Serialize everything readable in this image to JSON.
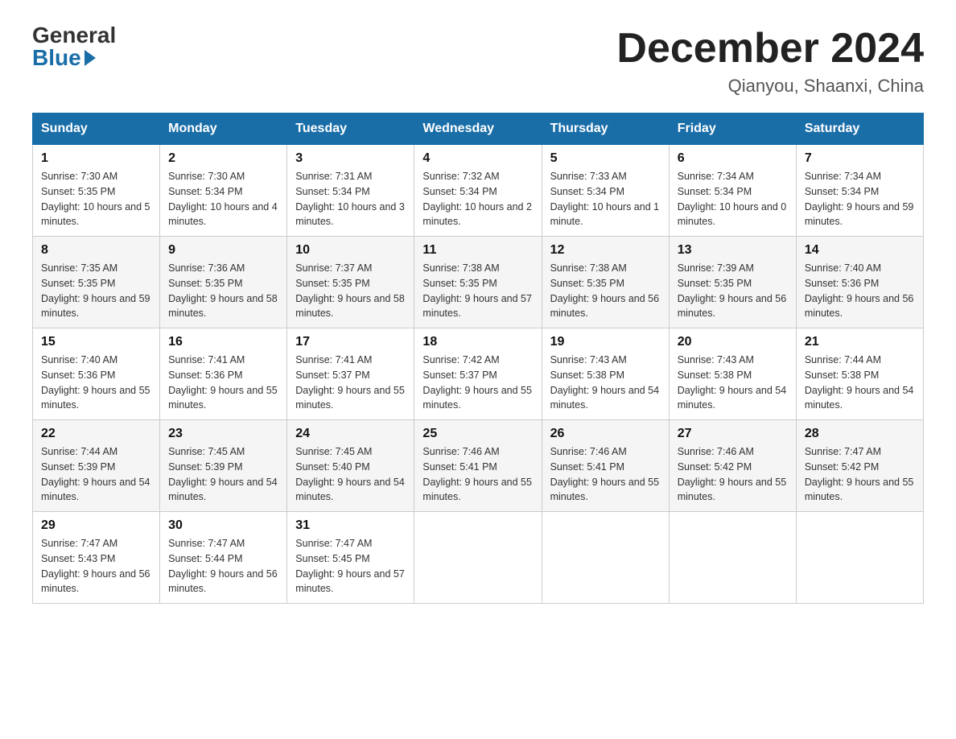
{
  "logo": {
    "general": "General",
    "blue": "Blue"
  },
  "header": {
    "month": "December 2024",
    "location": "Qianyou, Shaanxi, China"
  },
  "days_of_week": [
    "Sunday",
    "Monday",
    "Tuesday",
    "Wednesday",
    "Thursday",
    "Friday",
    "Saturday"
  ],
  "weeks": [
    [
      {
        "day": "1",
        "sunrise": "7:30 AM",
        "sunset": "5:35 PM",
        "daylight": "10 hours and 5 minutes."
      },
      {
        "day": "2",
        "sunrise": "7:30 AM",
        "sunset": "5:34 PM",
        "daylight": "10 hours and 4 minutes."
      },
      {
        "day": "3",
        "sunrise": "7:31 AM",
        "sunset": "5:34 PM",
        "daylight": "10 hours and 3 minutes."
      },
      {
        "day": "4",
        "sunrise": "7:32 AM",
        "sunset": "5:34 PM",
        "daylight": "10 hours and 2 minutes."
      },
      {
        "day": "5",
        "sunrise": "7:33 AM",
        "sunset": "5:34 PM",
        "daylight": "10 hours and 1 minute."
      },
      {
        "day": "6",
        "sunrise": "7:34 AM",
        "sunset": "5:34 PM",
        "daylight": "10 hours and 0 minutes."
      },
      {
        "day": "7",
        "sunrise": "7:34 AM",
        "sunset": "5:34 PM",
        "daylight": "9 hours and 59 minutes."
      }
    ],
    [
      {
        "day": "8",
        "sunrise": "7:35 AM",
        "sunset": "5:35 PM",
        "daylight": "9 hours and 59 minutes."
      },
      {
        "day": "9",
        "sunrise": "7:36 AM",
        "sunset": "5:35 PM",
        "daylight": "9 hours and 58 minutes."
      },
      {
        "day": "10",
        "sunrise": "7:37 AM",
        "sunset": "5:35 PM",
        "daylight": "9 hours and 58 minutes."
      },
      {
        "day": "11",
        "sunrise": "7:38 AM",
        "sunset": "5:35 PM",
        "daylight": "9 hours and 57 minutes."
      },
      {
        "day": "12",
        "sunrise": "7:38 AM",
        "sunset": "5:35 PM",
        "daylight": "9 hours and 56 minutes."
      },
      {
        "day": "13",
        "sunrise": "7:39 AM",
        "sunset": "5:35 PM",
        "daylight": "9 hours and 56 minutes."
      },
      {
        "day": "14",
        "sunrise": "7:40 AM",
        "sunset": "5:36 PM",
        "daylight": "9 hours and 56 minutes."
      }
    ],
    [
      {
        "day": "15",
        "sunrise": "7:40 AM",
        "sunset": "5:36 PM",
        "daylight": "9 hours and 55 minutes."
      },
      {
        "day": "16",
        "sunrise": "7:41 AM",
        "sunset": "5:36 PM",
        "daylight": "9 hours and 55 minutes."
      },
      {
        "day": "17",
        "sunrise": "7:41 AM",
        "sunset": "5:37 PM",
        "daylight": "9 hours and 55 minutes."
      },
      {
        "day": "18",
        "sunrise": "7:42 AM",
        "sunset": "5:37 PM",
        "daylight": "9 hours and 55 minutes."
      },
      {
        "day": "19",
        "sunrise": "7:43 AM",
        "sunset": "5:38 PM",
        "daylight": "9 hours and 54 minutes."
      },
      {
        "day": "20",
        "sunrise": "7:43 AM",
        "sunset": "5:38 PM",
        "daylight": "9 hours and 54 minutes."
      },
      {
        "day": "21",
        "sunrise": "7:44 AM",
        "sunset": "5:38 PM",
        "daylight": "9 hours and 54 minutes."
      }
    ],
    [
      {
        "day": "22",
        "sunrise": "7:44 AM",
        "sunset": "5:39 PM",
        "daylight": "9 hours and 54 minutes."
      },
      {
        "day": "23",
        "sunrise": "7:45 AM",
        "sunset": "5:39 PM",
        "daylight": "9 hours and 54 minutes."
      },
      {
        "day": "24",
        "sunrise": "7:45 AM",
        "sunset": "5:40 PM",
        "daylight": "9 hours and 54 minutes."
      },
      {
        "day": "25",
        "sunrise": "7:46 AM",
        "sunset": "5:41 PM",
        "daylight": "9 hours and 55 minutes."
      },
      {
        "day": "26",
        "sunrise": "7:46 AM",
        "sunset": "5:41 PM",
        "daylight": "9 hours and 55 minutes."
      },
      {
        "day": "27",
        "sunrise": "7:46 AM",
        "sunset": "5:42 PM",
        "daylight": "9 hours and 55 minutes."
      },
      {
        "day": "28",
        "sunrise": "7:47 AM",
        "sunset": "5:42 PM",
        "daylight": "9 hours and 55 minutes."
      }
    ],
    [
      {
        "day": "29",
        "sunrise": "7:47 AM",
        "sunset": "5:43 PM",
        "daylight": "9 hours and 56 minutes."
      },
      {
        "day": "30",
        "sunrise": "7:47 AM",
        "sunset": "5:44 PM",
        "daylight": "9 hours and 56 minutes."
      },
      {
        "day": "31",
        "sunrise": "7:47 AM",
        "sunset": "5:45 PM",
        "daylight": "9 hours and 57 minutes."
      },
      null,
      null,
      null,
      null
    ]
  ],
  "labels": {
    "sunrise": "Sunrise:",
    "sunset": "Sunset:",
    "daylight": "Daylight:"
  }
}
